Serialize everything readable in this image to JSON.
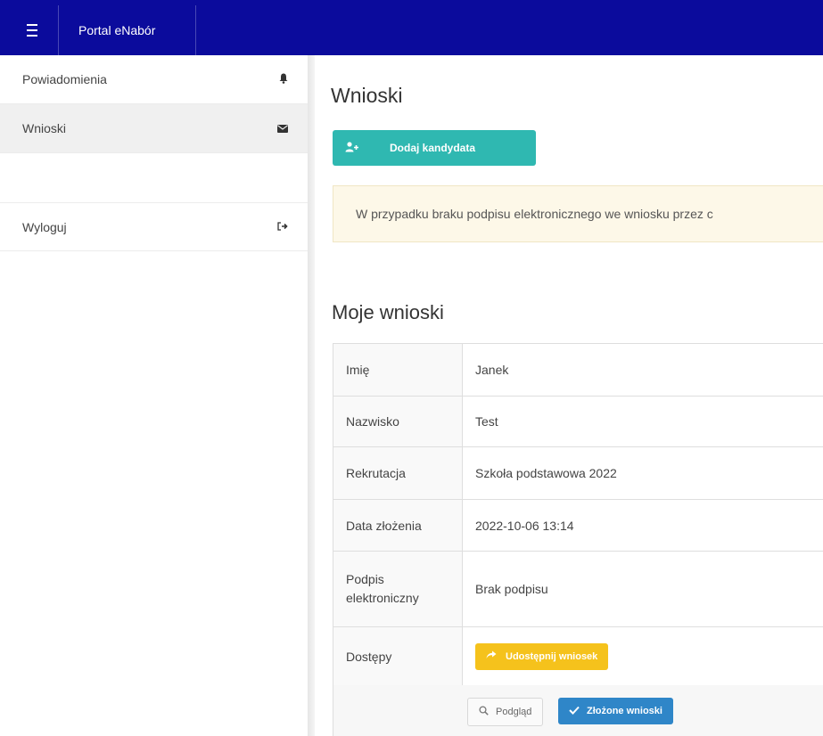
{
  "header": {
    "app_title": "Portal eNabór",
    "menu_icon": "hamburger-icon"
  },
  "sidebar": {
    "items": [
      {
        "label": "Powiadomienia",
        "icon": "bell-icon",
        "glyph": "🔔"
      },
      {
        "label": "Wnioski",
        "icon": "envelope-icon",
        "glyph": "✉"
      },
      {
        "label": "Wyloguj",
        "icon": "sign-out-icon",
        "glyph": "⇥"
      }
    ]
  },
  "main": {
    "title": "Wnioski",
    "add_button": {
      "label": "Dodaj kandydata",
      "icon": "user-plus-icon",
      "glyph": "👤+"
    },
    "alert_text": "W przypadku braku podpisu elektronicznego we wniosku przez c",
    "section_title": "Moje wnioski",
    "table": {
      "rows": [
        {
          "key": "Imię",
          "value": "Janek"
        },
        {
          "key": "Nazwisko",
          "value": "Test"
        },
        {
          "key": "Rekrutacja",
          "value": "Szkoła podstawowa 2022"
        },
        {
          "key": "Data złożenia",
          "value": "2022-10-06 13:14"
        },
        {
          "key": "Podpis elektroniczny",
          "value": "Brak podpisu"
        },
        {
          "key": "Dostępy",
          "button_label": "Udostępnij wniosek",
          "button_glyph": "➦"
        }
      ]
    },
    "footer": {
      "preview_label": "Podgląd",
      "preview_glyph": "🔍",
      "submitted_label": "Złożone wnioski",
      "submitted_glyph": "✔"
    }
  },
  "colors": {
    "topbar": "#0b0b9c",
    "teal": "#2fb8b1",
    "warning": "#f5c21c",
    "primary": "#2f86c8",
    "alert_bg": "#fdf8e8"
  }
}
